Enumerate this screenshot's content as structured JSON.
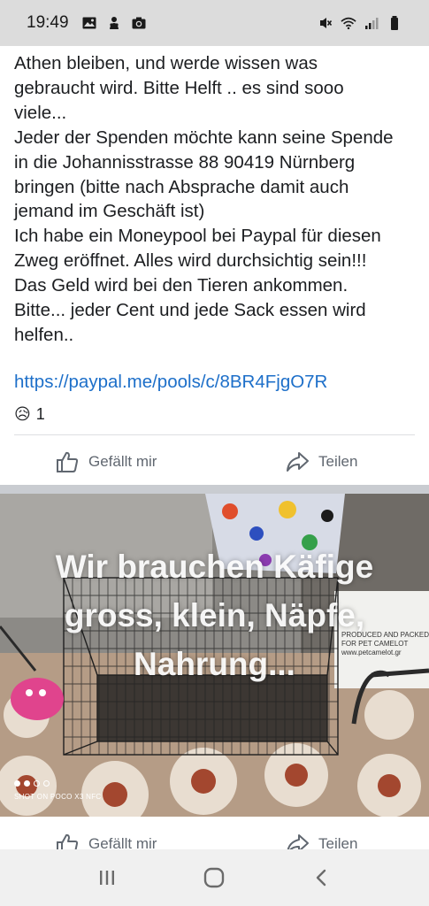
{
  "status_bar": {
    "time": "19:49",
    "left_icons": [
      "gallery-icon",
      "app-notification-icon",
      "camera-icon"
    ],
    "right_icons": [
      "mute-icon",
      "wifi-icon",
      "signal-icon",
      "battery-icon"
    ]
  },
  "post": {
    "text": "Athen bleiben, und werde wissen was\ngebraucht wird. Bitte Helft .. es sind sooo\nviele...\nJeder der Spenden möchte kann seine Spende\nin die Johannisstrasse 88 90419 Nürnberg\nbringen (bitte nach Absprache damit auch\njemand im Geschäft ist)\nIch habe ein Moneypool bei Paypal für diesen\nZweg eröffnet.  Alles wird durchsichtig sein!!!\nDas Geld wird bei den Tieren ankommen.\nBitte... jeder Cent und jede Sack essen wird\nhelfen..",
    "link": "https://paypal.me/pools/c/8BR4FjgO7R",
    "reaction_emoji": "😥",
    "reaction_count": "1",
    "like_label": "Gefällt mir",
    "share_label": "Teilen"
  },
  "photo": {
    "overlay_lines": [
      "Wir brauchen Käfige",
      "gross, klein, Näpfe,",
      "Nahrung..."
    ],
    "box_text_line1": "PRODUCED AND PACKED",
    "box_text_line2": "FOR PET CAMELOT",
    "box_text_line3": "www.petcamelot.gr",
    "watermark": "SHOT ON POCO X3 NFC"
  },
  "second_actions": {
    "like_label": "Gefällt mir",
    "share_label": "Teilen"
  },
  "nav_bar": {
    "buttons": [
      "recent-apps",
      "home",
      "back"
    ]
  }
}
